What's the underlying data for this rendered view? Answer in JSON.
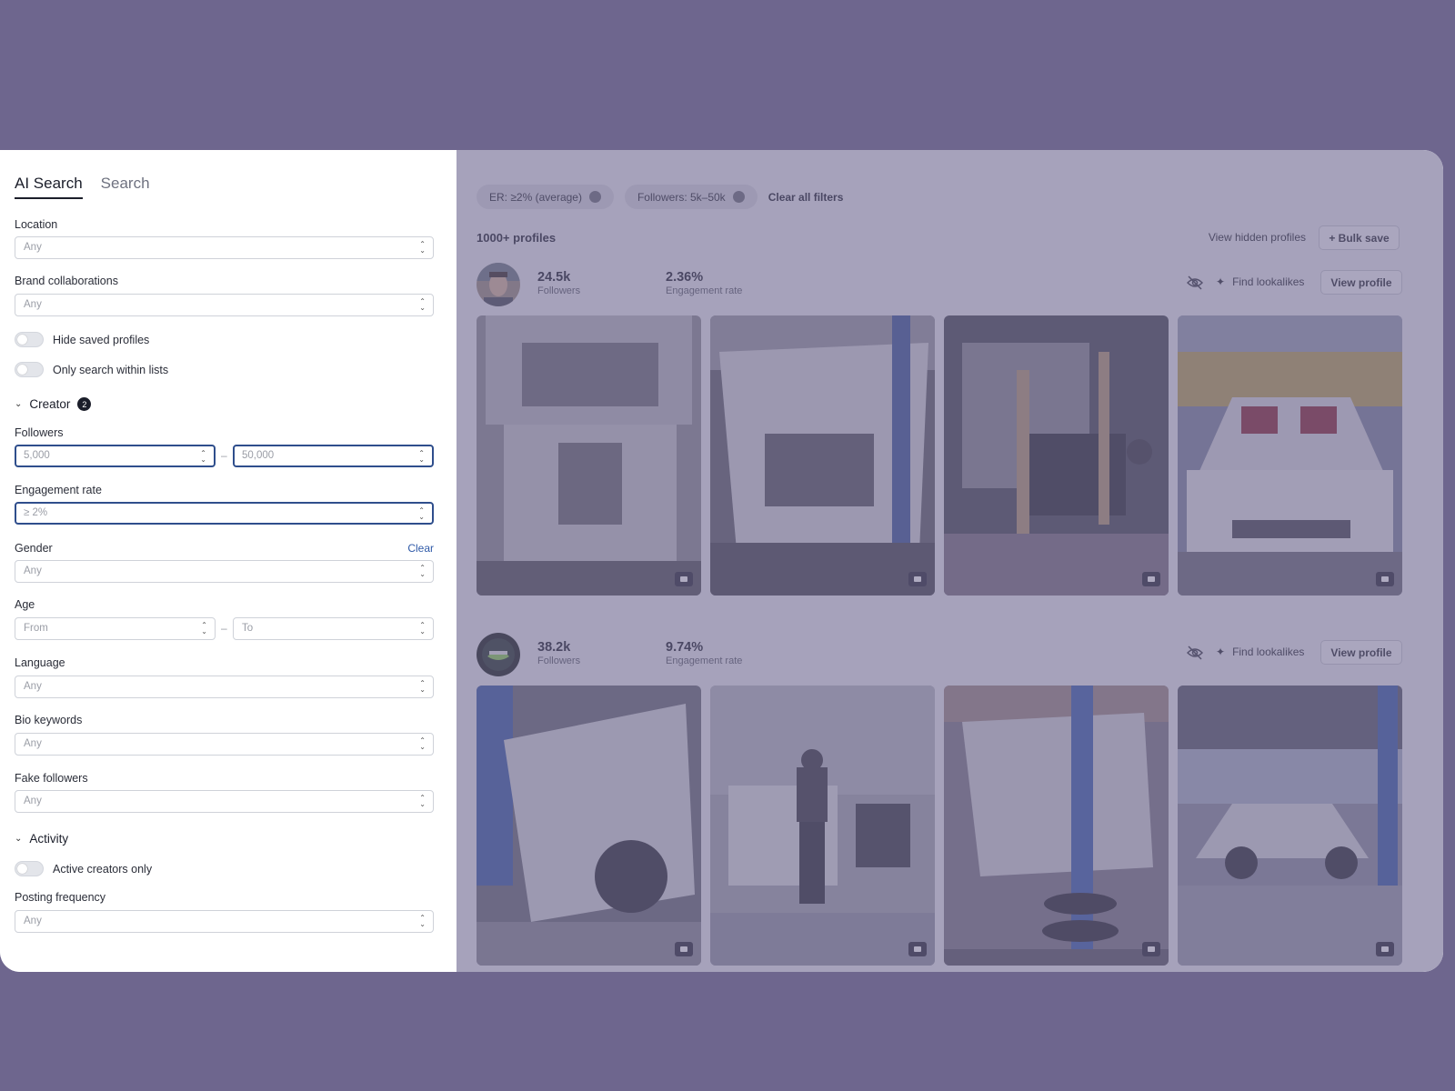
{
  "sidebar": {
    "tabs": [
      {
        "label": "AI Search"
      },
      {
        "label": "Search"
      }
    ],
    "location": {
      "label": "Location",
      "value": "Any"
    },
    "brand_collaborations": {
      "label": "Brand collaborations",
      "value": "Any"
    },
    "hide_saved": {
      "label": "Hide saved profiles",
      "on": false
    },
    "only_lists": {
      "label": "Only search within lists",
      "on": false
    },
    "creator_section": {
      "label": "Creator",
      "count": "2"
    },
    "followers": {
      "label": "Followers",
      "min": "5,000",
      "max": "50,000"
    },
    "engagement_rate": {
      "label": "Engagement rate",
      "value": "≥ 2%"
    },
    "gender": {
      "label": "Gender",
      "clear": "Clear",
      "value": "Any"
    },
    "age": {
      "label": "Age",
      "from": "From",
      "to": "To"
    },
    "language": {
      "label": "Language",
      "value": "Any"
    },
    "bio_keywords": {
      "label": "Bio keywords",
      "value": "Any"
    },
    "fake_followers": {
      "label": "Fake followers",
      "value": "Any"
    },
    "activity_section": {
      "label": "Activity"
    },
    "active_only": {
      "label": "Active creators only",
      "on": false
    },
    "posting_frequency": {
      "label": "Posting frequency",
      "value": "Any"
    },
    "range_separator": "–"
  },
  "main": {
    "chips": [
      {
        "label": "ER: ≥2% (average)"
      },
      {
        "label": "Followers: 5k–50k"
      }
    ],
    "clear_all": "Clear all filters",
    "count": "1000+ profiles",
    "view_hidden": "View hidden profiles",
    "bulk_save": "+ Bulk save",
    "profiles": [
      {
        "followers": "24.5k",
        "followers_label": "Followers",
        "er": "2.36%",
        "er_label": "Engagement rate",
        "lookalikes": "Find lookalikes",
        "view": "View profile"
      },
      {
        "followers": "38.2k",
        "followers_label": "Followers",
        "er": "9.74%",
        "er_label": "Engagement rate",
        "lookalikes": "Find lookalikes",
        "view": "View profile"
      }
    ]
  },
  "colors": {
    "backdrop": "#6e668e",
    "accent": "#2f4e8c",
    "link": "#2f5aa8"
  }
}
